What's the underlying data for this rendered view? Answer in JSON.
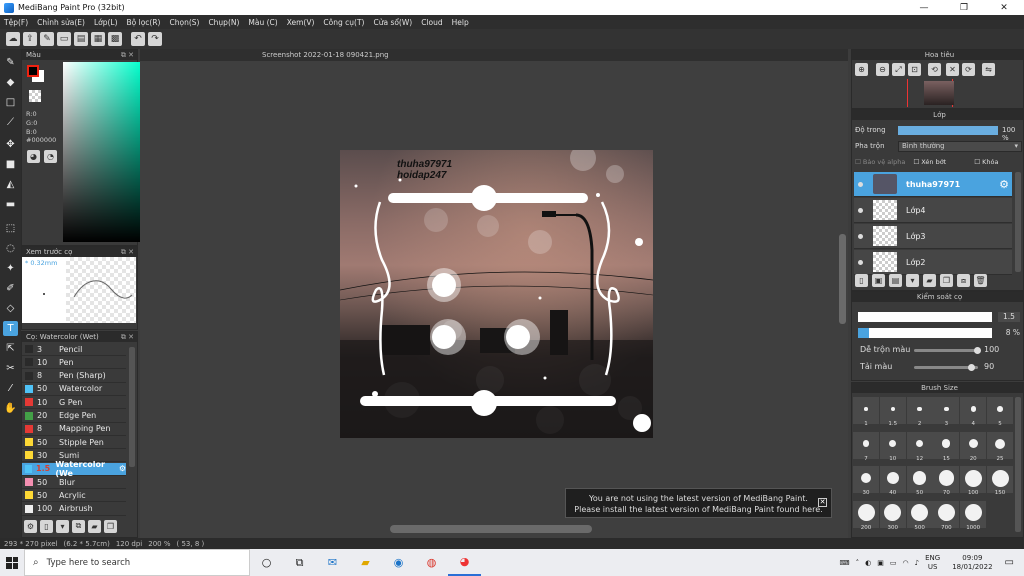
{
  "window": {
    "title": "MediBang Paint Pro (32bit)",
    "minimize": "—",
    "maximize": "❐",
    "close": "✕"
  },
  "menu": [
    "Tệp(F)",
    "Chỉnh sửa(E)",
    "Lớp(L)",
    "Bộ lọc(R)",
    "Chọn(S)",
    "Chụp(N)",
    "Màu (C)",
    "Xem(V)",
    "Công cụ(T)",
    "Cửa sổ(W)",
    "Cloud",
    "Help"
  ],
  "color_panel": {
    "title": "Màu",
    "r": "R:0",
    "g": "G:0",
    "b": "B:0",
    "hex": "#000000",
    "accent": "#4aa3df"
  },
  "preview_panel": {
    "title": "Xem trước cọ",
    "size": "* 0.32mm"
  },
  "brush_panel": {
    "title": "Cọ: Watercolor (Wet)",
    "brushes": [
      {
        "num": "3",
        "name": "Pencil",
        "color": "#2a2a2a"
      },
      {
        "num": "10",
        "name": "Pen",
        "color": "#2a2a2a"
      },
      {
        "num": "8",
        "name": "Pen (Sharp)",
        "color": "#2a2a2a"
      },
      {
        "num": "50",
        "name": "Watercolor",
        "color": "#4fc3f7"
      },
      {
        "num": "10",
        "name": "G Pen",
        "color": "#e53935"
      },
      {
        "num": "20",
        "name": "Edge Pen",
        "color": "#43a047"
      },
      {
        "num": "8",
        "name": "Mapping Pen",
        "color": "#e53935"
      },
      {
        "num": "50",
        "name": "Stipple Pen",
        "color": "#fdd835"
      },
      {
        "num": "30",
        "name": "Sumi",
        "color": "#fdd835"
      },
      {
        "num": "1.5",
        "name": "Watercolor (We",
        "color": "#4fc3f7",
        "selected": true
      },
      {
        "num": "50",
        "name": "Blur",
        "color": "#f48fb1"
      },
      {
        "num": "50",
        "name": "Acrylic",
        "color": "#fdd835"
      },
      {
        "num": "100",
        "name": "Airbrush",
        "color": "#eeeeee"
      }
    ]
  },
  "canvas": {
    "tab": "Screenshot 2022-01-18 090421.png",
    "watermark_line1": "thuha97971",
    "watermark_line2": "hoidap247"
  },
  "toast": {
    "line1": "You are not using the latest version of MediBang Paint.",
    "line2": "Please install the latest version of MediBang Paint found here.",
    "close": "✕"
  },
  "navigator": {
    "title": "Hoa tiêu"
  },
  "layer_panel": {
    "title": "Lớp",
    "opacity_label": "Độ trong",
    "opacity_value": "100 %",
    "opacity_fraction": 1.0,
    "blend_label": "Pha trộn",
    "blend_value": "Bình thường",
    "protect_alpha": "Bảo vệ alpha",
    "clipping": "Xén bớt",
    "lock": "Khóa",
    "layers": [
      {
        "name": "thuha97971",
        "selected": true
      },
      {
        "name": "Lớp4"
      },
      {
        "name": "Lớp3"
      },
      {
        "name": "Lớp2"
      }
    ]
  },
  "brush_control": {
    "title": "Kiểm soát cọ",
    "size_value": "1.5",
    "opacity_value": "8 %",
    "opacity_fraction": 0.08,
    "mix_label": "Dễ trộn màu",
    "mix_value": "100",
    "mix_fraction": 1.0,
    "load_label": "Tải màu",
    "load_value": "90",
    "load_fraction": 0.9
  },
  "brush_size": {
    "title": "Brush Size",
    "sizes": [
      "1",
      "1.5",
      "2",
      "3",
      "4",
      "5",
      "7",
      "10",
      "12",
      "15",
      "20",
      "25",
      "30",
      "40",
      "50",
      "70",
      "100",
      "150",
      "200",
      "300",
      "500",
      "700",
      "1000"
    ]
  },
  "status": {
    "dimensions": "293 * 270 pixel",
    "physical": "(6.2 * 5.7cm)",
    "dpi": "120 dpi",
    "zoom": "200 %",
    "coords": "( 53, 8 )"
  },
  "taskbar": {
    "search_placeholder": "Type here to search",
    "lang1": "ENG",
    "lang2": "US",
    "time": "09:09",
    "date": "18/01/2022"
  }
}
